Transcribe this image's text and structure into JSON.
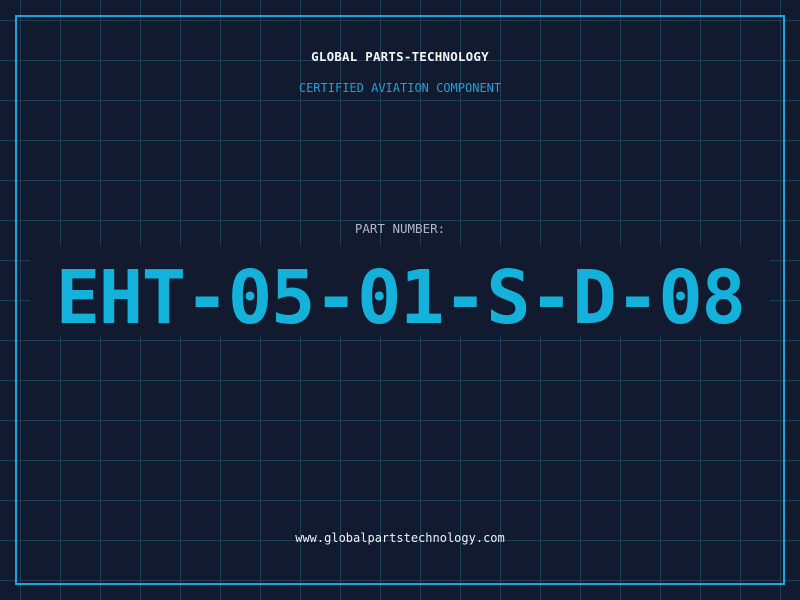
{
  "header": {
    "company_name": "GLOBAL PARTS-TECHNOLOGY",
    "tagline": "CERTIFIED AVIATION COMPONENT"
  },
  "part": {
    "label": "PART NUMBER:",
    "number": "EHT-05-01-S-D-08"
  },
  "footer": {
    "website": "www.globalpartstechnology.com"
  },
  "colors": {
    "background": "#111a2e",
    "grid": "#1d3f5a",
    "accent": "#14b1db",
    "frame": "#1aa7d6"
  }
}
